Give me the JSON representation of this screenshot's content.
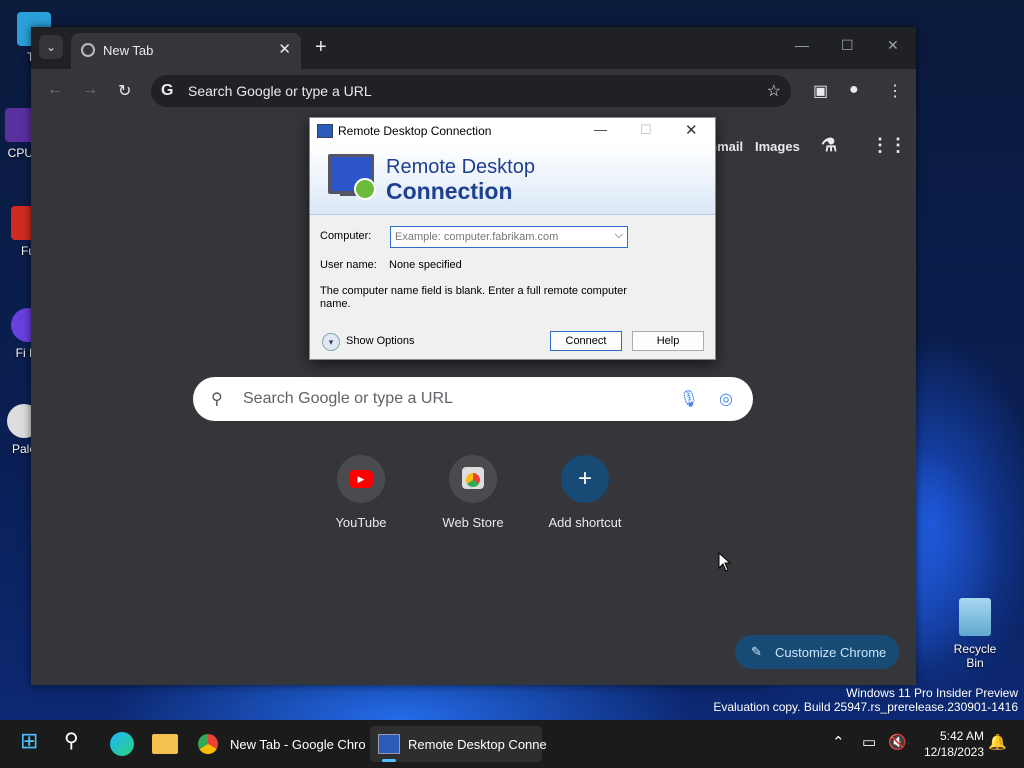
{
  "desktop": {
    "icons": [
      "Th",
      "CPUI",
      "Fu",
      "Fi Ni",
      "Pale"
    ],
    "recycle_bin": "Recycle Bin",
    "watermark_line1": "Windows 11 Pro Insider Preview",
    "watermark_line2": "Evaluation copy. Build 25947.rs_prerelease.230901-1416"
  },
  "chrome": {
    "tab_title": "New Tab",
    "omnibox_placeholder": "Search Google or type a URL",
    "top_links": {
      "gmail": "Gmail",
      "images": "Images"
    },
    "search_placeholder": "Search Google or type a URL",
    "shortcuts": [
      {
        "label": "YouTube"
      },
      {
        "label": "Web Store"
      },
      {
        "label": "Add shortcut"
      }
    ],
    "customize_label": "Customize Chrome"
  },
  "rdc": {
    "title": "Remote Desktop Connection",
    "banner_line1": "Remote Desktop",
    "banner_line2": "Connection",
    "computer_label": "Computer:",
    "computer_placeholder": "Example: computer.fabrikam.com",
    "username_label": "User name:",
    "username_value": "None specified",
    "message": "The computer name field is blank.  Enter a full remote computer name.",
    "show_options": "Show Options",
    "connect": "Connect",
    "help": "Help"
  },
  "taskbar": {
    "apps": [
      {
        "label": "New Tab - Google Chro"
      },
      {
        "label": "Remote Desktop Conne"
      }
    ],
    "time": "5:42 AM",
    "date": "12/18/2023"
  }
}
